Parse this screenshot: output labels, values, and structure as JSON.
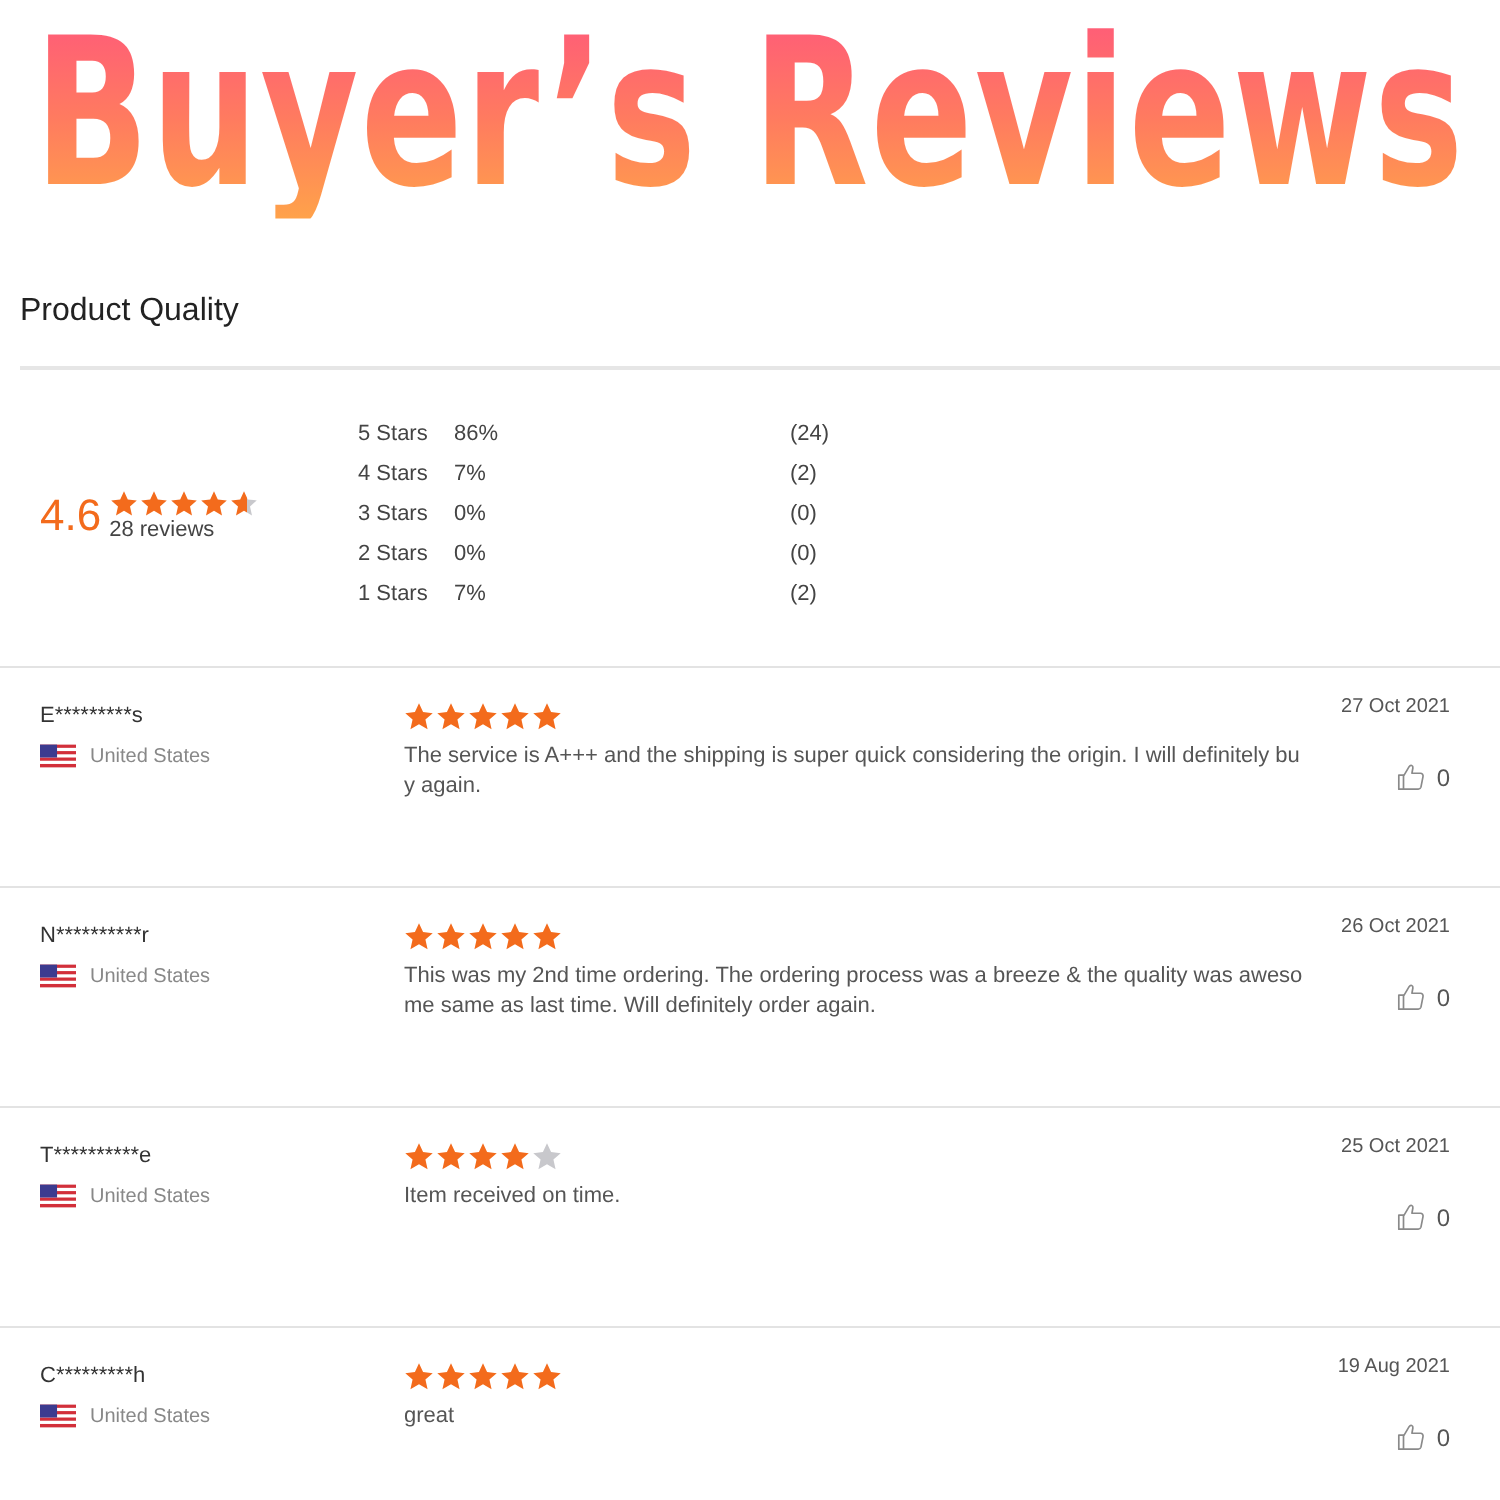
{
  "banner": {
    "title": "Buyer’s Reviews"
  },
  "section": {
    "title": "Product Quality"
  },
  "summary": {
    "rating": "4.6",
    "stars": 4.6,
    "count": "28 reviews",
    "breakdown": [
      {
        "label": "5 Stars",
        "percent": "86%",
        "count": "(24)"
      },
      {
        "label": "4 Stars",
        "percent": "7%",
        "count": "(2)"
      },
      {
        "label": "3 Stars",
        "percent": "0%",
        "count": "(0)"
      },
      {
        "label": "2 Stars",
        "percent": "0%",
        "count": "(0)"
      },
      {
        "label": "1 Stars",
        "percent": "7%",
        "count": "(2)"
      }
    ]
  },
  "reviews": [
    {
      "name": "E*********s",
      "country": "United States",
      "stars": 5,
      "text": "The service is A+++ and the shipping is super quick considering the origin. I will definitely buy again.",
      "date": "27 Oct 2021",
      "likes": "0"
    },
    {
      "name": "N**********r",
      "country": "United States",
      "stars": 5,
      "text": "This was my 2nd time ordering. The ordering process was a breeze & the quality was awesome same as last time. Will definitely order again.",
      "date": "26 Oct 2021",
      "likes": "0"
    },
    {
      "name": "T**********e",
      "country": "United States",
      "stars": 4,
      "text": "Item received on time.",
      "date": "25 Oct 2021",
      "likes": "0"
    },
    {
      "name": "C*********h",
      "country": "United States",
      "stars": 5,
      "text": "great",
      "date": "19 Aug 2021",
      "likes": "0"
    }
  ]
}
